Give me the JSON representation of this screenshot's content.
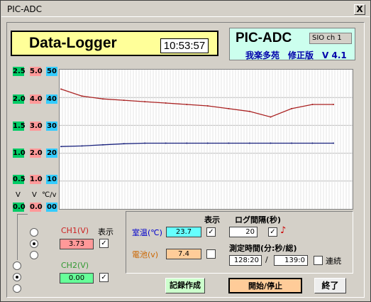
{
  "window": {
    "title": "PIC-ADC",
    "close_glyph": "X"
  },
  "header": {
    "logger_title": "Data-Logger",
    "clock": "10:53:57",
    "brand_title": "PIC-ADC",
    "sio": "SIO ch 1",
    "version": "我楽多苑　修正版　V 4.1"
  },
  "axes": {
    "col1": [
      "2.5",
      "2.0",
      "1.5",
      "1.0",
      "0.5"
    ],
    "col2": [
      "5.0",
      "4.0",
      "3.0",
      "2.0",
      "1.0"
    ],
    "col3": [
      "50",
      "40",
      "30",
      "20",
      "10"
    ],
    "unit1": "V",
    "unit2": "V",
    "unit3": "℃/v",
    "zero1": "0.0",
    "zero2": "0.0",
    "zero3": "00"
  },
  "channels": {
    "ch1_label": "CH1(V)",
    "ch1_value": "3.73",
    "ch2_label": "CH2(V)",
    "ch2_value": "0.00",
    "show_label": "表示"
  },
  "readings": {
    "show_label": "表示",
    "room_label": "室温(℃)",
    "room_value": "23.7",
    "battery_label": "電池(v)",
    "battery_value": "7.4"
  },
  "logging": {
    "interval_label": "ログ間隔(秒)",
    "interval_value": "20",
    "time_label": "測定時間(分:秒/総)",
    "elapsed": "128:20",
    "separator": "/",
    "total": "139:0",
    "continuous_label": "連続",
    "note_glyph": "♪"
  },
  "buttons": {
    "record": "記録作成",
    "startstop": "開始/停止",
    "end": "終了"
  },
  "colors": {
    "ch1": "#aa2222",
    "ch2": "#1a237e",
    "green": "#00cc66",
    "pink": "#ff9999",
    "cyan": "#33ccff"
  },
  "chart_data": {
    "type": "line",
    "y_ranges": {
      "ch1_v": [
        0,
        5
      ],
      "ch2_v": [
        0,
        2.5
      ],
      "temp_c": [
        0,
        50
      ]
    },
    "series": [
      {
        "name": "CH1(V)",
        "values": [
          4.3,
          4.05,
          3.95,
          3.9,
          3.85,
          3.8,
          3.75,
          3.7,
          3.6,
          3.5,
          3.3,
          3.6,
          3.75,
          3.75
        ]
      },
      {
        "name": "CH2",
        "values": [
          1.12,
          1.13,
          1.15,
          1.17,
          1.18,
          1.18,
          1.18,
          1.18,
          1.18,
          1.18,
          1.18,
          1.18,
          1.18,
          1.18
        ]
      }
    ]
  }
}
